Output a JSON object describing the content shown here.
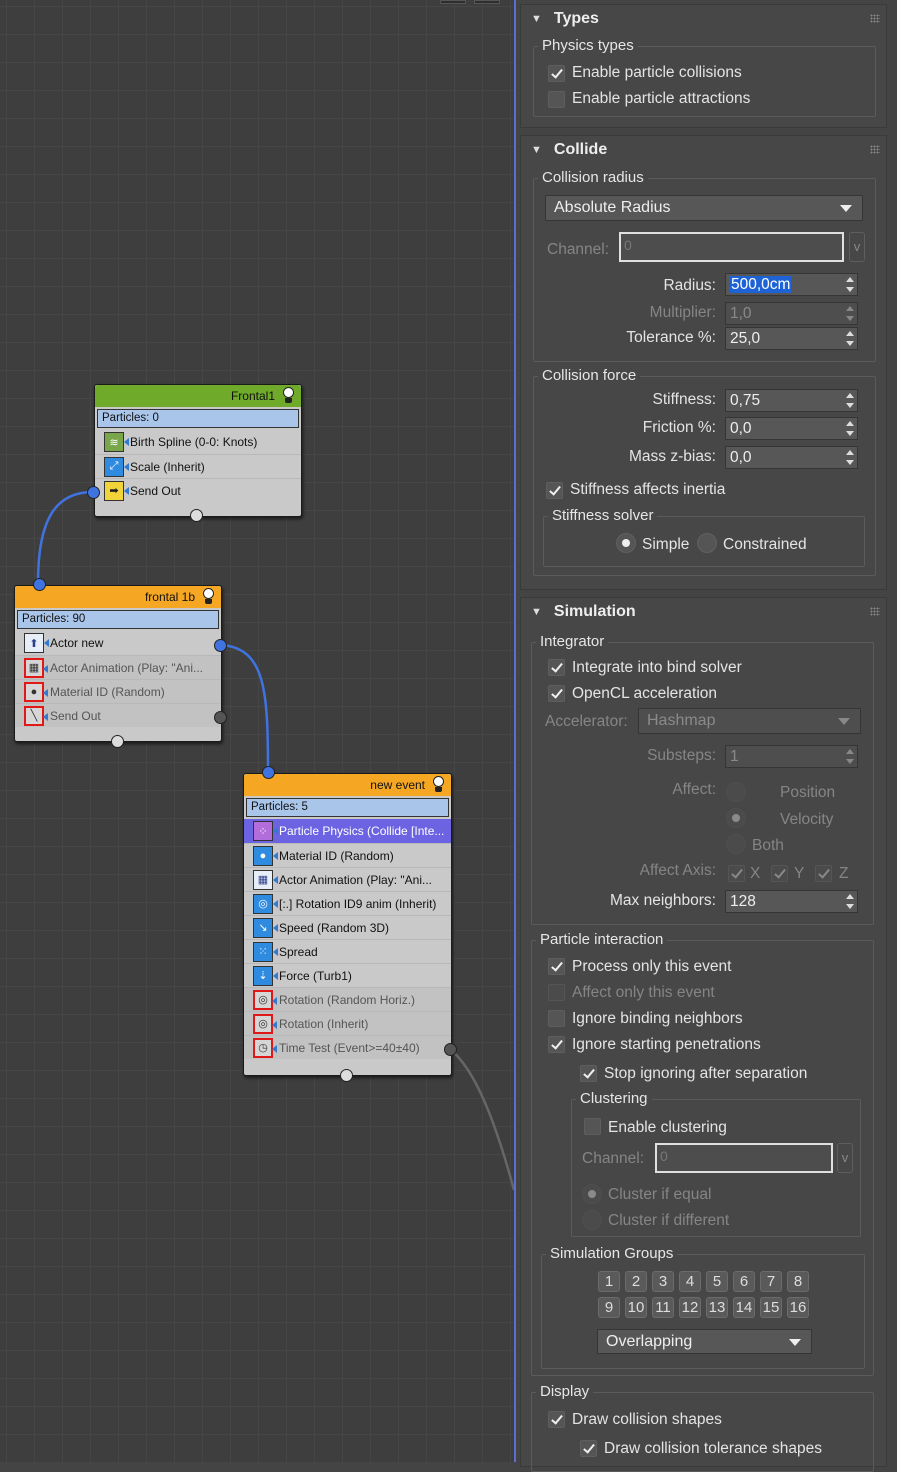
{
  "graph": {
    "node_frontal1": {
      "title": "Frontal1",
      "particles": "Particles: 0",
      "color": "#6faa2a",
      "operators": [
        "Birth Spline (0-0: Knots)",
        "Scale (Inherit)",
        "Send Out"
      ]
    },
    "node_frontal1b": {
      "title": "frontal 1b",
      "particles": "Particles: 90",
      "color": "#f5a623",
      "operators": [
        "Actor new",
        "Actor Animation (Play: \"Ani...",
        "Material ID (Random)",
        "Send Out"
      ]
    },
    "node_newevent": {
      "title": "new event",
      "particles": "Particles: 5",
      "color": "#f5a623",
      "operators": [
        "Particle Physics (Collide [Inte...",
        "Material ID (Random)",
        "Actor Animation (Play: \"Ani...",
        "[:.] Rotation ID9 anim (Inherit)",
        "Speed (Random 3D)",
        "Spread",
        "Force (Turb1)",
        "Rotation (Random Horiz.)",
        "Rotation (Inherit)",
        "Time Test (Event>=40±40)"
      ]
    },
    "wire_color": "#3f73e0"
  },
  "panel": {
    "types": {
      "title": "Types",
      "group": "Physics types",
      "enable_collisions": "Enable particle collisions",
      "enable_attractions": "Enable particle attractions"
    },
    "collide": {
      "title": "Collide",
      "radius_group": "Collision radius",
      "radius_mode": "Absolute Radius",
      "channel_label": "Channel:",
      "channel_value": "0",
      "channel_btn": "v",
      "radius_label": "Radius:",
      "radius_value": "500,0cm",
      "multiplier_label": "Multiplier:",
      "multiplier_value": "1,0",
      "tolerance_label": "Tolerance %:",
      "tolerance_value": "25,0",
      "force_group": "Collision force",
      "stiffness_label": "Stiffness:",
      "stiffness_value": "0,75",
      "friction_label": "Friction %:",
      "friction_value": "0,0",
      "massz_label": "Mass z-bias:",
      "massz_value": "0,0",
      "stiffness_inertia": "Stiffness affects inertia",
      "solver_group": "Stiffness solver",
      "solver_simple": "Simple",
      "solver_constrained": "Constrained"
    },
    "simulation": {
      "title": "Simulation",
      "integrator_group": "Integrator",
      "integrate_bind": "Integrate into bind solver",
      "opencl": "OpenCL acceleration",
      "accelerator_label": "Accelerator:",
      "accelerator_value": "Hashmap",
      "substeps_label": "Substeps:",
      "substeps_value": "1",
      "affect_label": "Affect:",
      "affect_position": "Position",
      "affect_velocity": "Velocity",
      "affect_both": "Both",
      "axis_label": "Affect Axis:",
      "axis_x": "X",
      "axis_y": "Y",
      "axis_z": "Z",
      "maxn_label": "Max neighbors:",
      "maxn_value": "128",
      "interaction_group": "Particle interaction",
      "process_only": "Process only this event",
      "affect_only": "Affect only this event",
      "ignore_binding": "Ignore binding neighbors",
      "ignore_starting": "Ignore starting penetrations",
      "stop_ignoring": "Stop ignoring after separation",
      "clustering_group": "Clustering",
      "enable_clustering": "Enable clustering",
      "cl_channel_label": "Channel:",
      "cl_channel_value": "0",
      "cl_channel_btn": "v",
      "cluster_equal": "Cluster if equal",
      "cluster_different": "Cluster if different",
      "groups_group": "Simulation Groups",
      "groups_row1": [
        "1",
        "2",
        "3",
        "4",
        "5",
        "6",
        "7",
        "8"
      ],
      "groups_row2": [
        "9",
        "10",
        "11",
        "12",
        "13",
        "14",
        "15",
        "16"
      ],
      "groups_mode": "Overlapping",
      "display_group": "Display",
      "draw_shapes": "Draw collision shapes",
      "draw_tolerance": "Draw collision tolerance shapes"
    }
  }
}
